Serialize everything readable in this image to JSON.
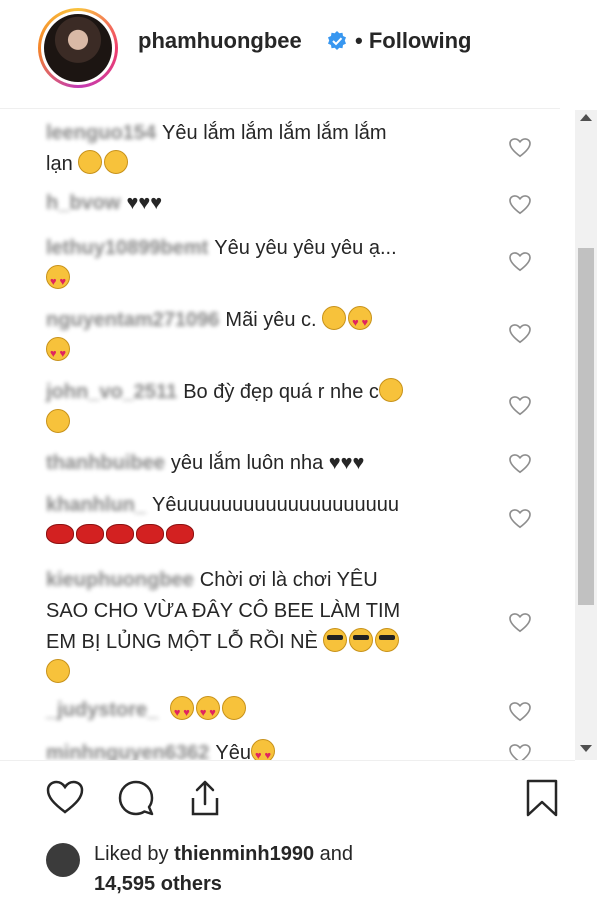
{
  "post_header": {
    "username": "phamhuongbee",
    "dot_separator": "•",
    "following_label": "Following"
  },
  "comments": [
    {
      "text1": "Yêu lắm lắm lắm lắm lắm",
      "text2": "lạn"
    },
    {
      "text": "♥♥♥"
    },
    {
      "text": "Yêu yêu yêu yêu ạ..."
    },
    {
      "text": "Mãi yêu c."
    },
    {
      "text": "Bo đỳ đẹp quá r nhe c"
    },
    {
      "text": "yêu lắm luôn nha ♥♥♥"
    },
    {
      "text": "Yêuuuuuuuuuuuuuuuuuuuu"
    },
    {
      "text1": "Chời ơi là chơi YÊU",
      "text2": "SAO CHO VỪA ĐÂY CÔ BEE LÀM TIM",
      "text3": "EM BỊ LỦNG MỘT LỖ RỒI NÈ"
    },
    {
      "text": ""
    },
    {
      "text": "Yêu"
    }
  ],
  "blurred_usernames": [
    "leenguo154",
    "h_bvow",
    "lethuy10899bemt",
    "nguyentam271096",
    "john_vo_2511",
    "thanhbuibee",
    "khanhlun_",
    "kieuphuongbee",
    "_judystore_",
    "minhnguyen6362"
  ],
  "likes": {
    "prefix": "Liked by",
    "user": "thienminh1990",
    "and": "and",
    "count_text": "14,595 others"
  },
  "icons": [
    "verified-icon",
    "like-icon",
    "comment-icon",
    "share-icon",
    "save-icon"
  ],
  "colors": {
    "verified": "#3897f0",
    "text": "#262626",
    "border": "#efefef"
  }
}
